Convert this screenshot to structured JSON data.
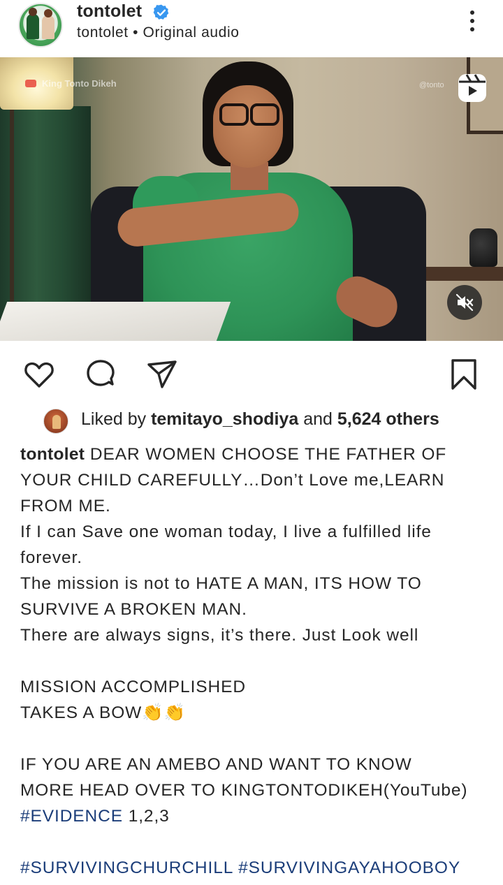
{
  "post": {
    "username": "tontolet",
    "subtitle": "tontolet • Original audio",
    "verified": true
  },
  "video": {
    "watermark_left": "King Tonto Dikeh",
    "watermark_right": "@tonto",
    "muted": true
  },
  "likes": {
    "prefix": "Liked by ",
    "liker": "temitayo_shodiya",
    "middle": " and ",
    "others": "5,624 others"
  },
  "caption": {
    "author": "tontolet",
    "line1": " DEAR WOMEN CHOOSE THE FATHER OF",
    "line2": "YOUR CHILD CAREFULLY…Don’t Love me,LEARN",
    "line3": "FROM ME.",
    "line4": "If I can Save one woman today, I live a fulfilled life",
    "line5": "forever.",
    "line6": "The mission is not to HATE A MAN, ITS HOW TO",
    "line7": "SURVIVE A BROKEN MAN.",
    "line8": "There are always signs, it’s there. Just Look well",
    "line9": "MISSION ACCOMPLISHED",
    "line10": "TAKES A BOW👏👏",
    "line11": "IF YOU ARE AN AMEBO AND WANT TO KNOW",
    "line12": "MORE HEAD OVER TO KINGTONTODIKEH(YouTube)",
    "hashtag_evidence": "#EVIDENCE",
    "evidence_suffix": " 1,2,3",
    "hashtag1": "#SURVIVINGCHURCHILL",
    "hashtag2": "#SURVIVINGAYAHOOBOY"
  },
  "colors": {
    "text": "#262626",
    "hashtag": "#1b3d79",
    "verified": "#3897f0"
  },
  "icons": [
    "more-options-icon",
    "verified-badge-icon",
    "reels-icon",
    "mute-icon",
    "heart-icon",
    "comment-icon",
    "share-icon",
    "bookmark-icon"
  ]
}
